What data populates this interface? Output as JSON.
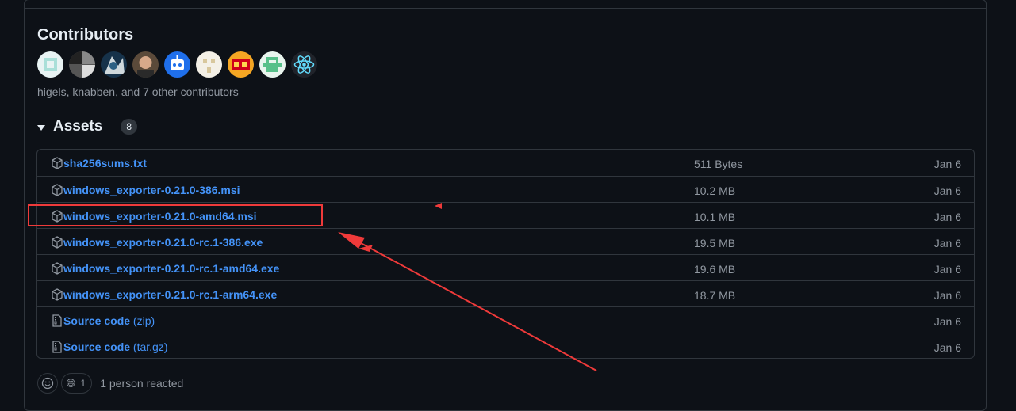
{
  "contributors": {
    "title": "Contributors",
    "summary": "higels, knabben, and 7 other contributors",
    "avatars": [
      "avatar-1",
      "avatar-2",
      "avatar-3",
      "avatar-4",
      "avatar-5",
      "avatar-6",
      "avatar-7",
      "avatar-8",
      "avatar-9"
    ]
  },
  "assets": {
    "title": "Assets",
    "count": "8",
    "items": [
      {
        "name": "sha256sums.txt",
        "suffix": "",
        "size": "511 Bytes",
        "date": "Jan 6",
        "icon": "package-icon"
      },
      {
        "name": "windows_exporter-0.21.0-386.msi",
        "suffix": "",
        "size": "10.2 MB",
        "date": "Jan 6",
        "icon": "package-icon"
      },
      {
        "name": "windows_exporter-0.21.0-amd64.msi",
        "suffix": "",
        "size": "10.1 MB",
        "date": "Jan 6",
        "icon": "package-icon"
      },
      {
        "name": "windows_exporter-0.21.0-rc.1-386.exe",
        "suffix": "",
        "size": "19.5 MB",
        "date": "Jan 6",
        "icon": "package-icon"
      },
      {
        "name": "windows_exporter-0.21.0-rc.1-amd64.exe",
        "suffix": "",
        "size": "19.6 MB",
        "date": "Jan 6",
        "icon": "package-icon"
      },
      {
        "name": "windows_exporter-0.21.0-rc.1-arm64.exe",
        "suffix": "",
        "size": "18.7 MB",
        "date": "Jan 6",
        "icon": "package-icon"
      },
      {
        "name": "Source code",
        "suffix": " (zip)",
        "size": "",
        "date": "Jan 6",
        "icon": "file-zip-icon"
      },
      {
        "name": "Source code",
        "suffix": " (tar.gz)",
        "size": "",
        "date": "Jan 6",
        "icon": "file-zip-icon"
      }
    ]
  },
  "reactions": {
    "count": "1",
    "emoji": "😄",
    "text": "1 person reacted"
  },
  "annotation": {
    "color": "#ef3a3a"
  }
}
